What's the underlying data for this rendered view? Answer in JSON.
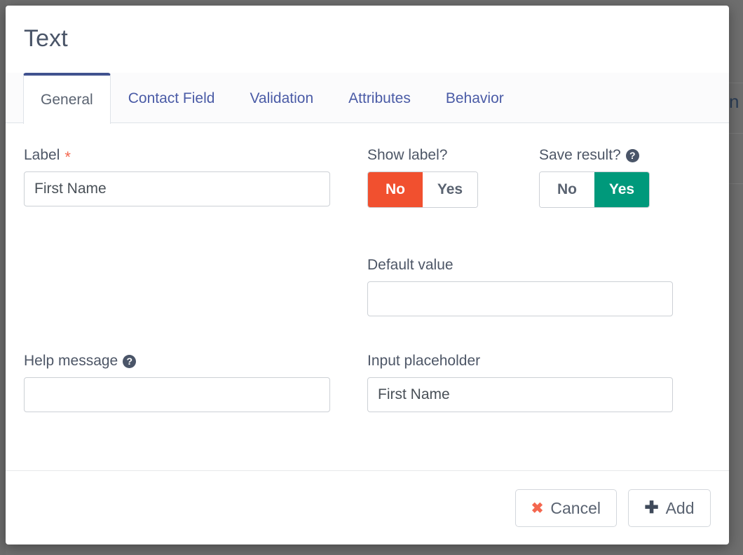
{
  "modal": {
    "title": "Text",
    "tabs": [
      {
        "label": "General",
        "active": true
      },
      {
        "label": "Contact Field",
        "active": false
      },
      {
        "label": "Validation",
        "active": false
      },
      {
        "label": "Attributes",
        "active": false
      },
      {
        "label": "Behavior",
        "active": false
      }
    ],
    "fields": {
      "label": {
        "label": "Label",
        "required_marker": "*",
        "value": "First Name",
        "placeholder": "First Name"
      },
      "show_label": {
        "label": "Show label?",
        "options": [
          "No",
          "Yes"
        ],
        "selected": "No"
      },
      "save_result": {
        "label": "Save result?",
        "help_icon": "question-circle-icon",
        "help_glyph": "?",
        "options": [
          "No",
          "Yes"
        ],
        "selected": "Yes"
      },
      "default_value": {
        "label": "Default value",
        "value": "",
        "placeholder": ""
      },
      "help_message": {
        "label": "Help message",
        "help_icon": "question-circle-icon",
        "help_glyph": "?",
        "value": "",
        "placeholder": ""
      },
      "input_placeholder": {
        "label": "Input placeholder",
        "value": "First Name",
        "placeholder": "First Name"
      }
    },
    "footer": {
      "cancel": {
        "label": "Cancel",
        "icon": "close-x-icon",
        "glyph": "✖"
      },
      "add": {
        "label": "Add",
        "icon": "plus-icon",
        "glyph": "✚"
      }
    }
  },
  "background": {
    "text_fragment": "n"
  },
  "colors": {
    "accent_tab": "#41528f",
    "tab_link": "#4a5ba6",
    "toggle_no": "#f1502f",
    "toggle_yes": "#00997b",
    "required": "#f4674f",
    "text": "#4d5666",
    "backdrop": "#6e6e6e"
  }
}
